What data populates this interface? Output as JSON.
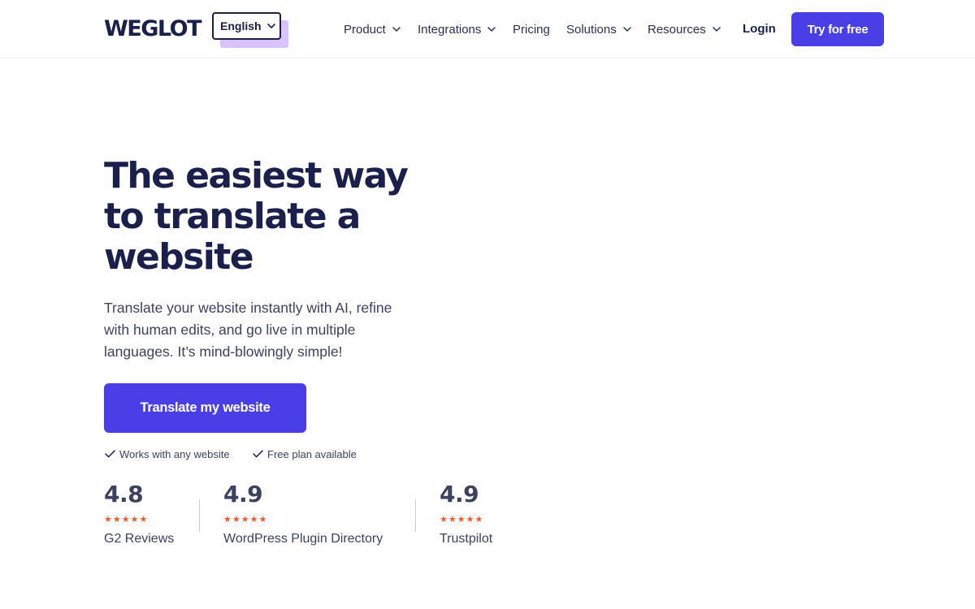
{
  "header": {
    "logo": "WEGLOT",
    "language": "English",
    "nav": [
      {
        "label": "Product",
        "has_dropdown": true
      },
      {
        "label": "Integrations",
        "has_dropdown": true
      },
      {
        "label": "Pricing",
        "has_dropdown": false
      },
      {
        "label": "Solutions",
        "has_dropdown": true
      },
      {
        "label": "Resources",
        "has_dropdown": true
      }
    ],
    "login": "Login",
    "cta": "Try for free"
  },
  "hero": {
    "title": "The easiest way to translate a website",
    "subtitle": "Translate your website instantly with AI, refine with human edits, and go live in multiple languages. It’s mind-blowingly simple!",
    "cta": "Translate my website",
    "checks": [
      "Works with any website",
      "Free plan available"
    ]
  },
  "ratings": [
    {
      "score": "4.8",
      "stars": 5,
      "source": "G2 Reviews"
    },
    {
      "score": "4.9",
      "stars": 5,
      "source": "WordPress Plugin Directory"
    },
    {
      "score": "4.9",
      "stars": 5,
      "source": "Trustpilot"
    }
  ],
  "colors": {
    "brand_primary": "#4a3ee6",
    "text_dark": "#1b1f4b",
    "text_body": "#3d4160",
    "star": "#ee5a2d",
    "lang_shadow": "#d9c3ff"
  },
  "icons": {
    "dropdown": "chevron-down-icon",
    "check": "checkmark-icon",
    "star": "star-icon"
  }
}
